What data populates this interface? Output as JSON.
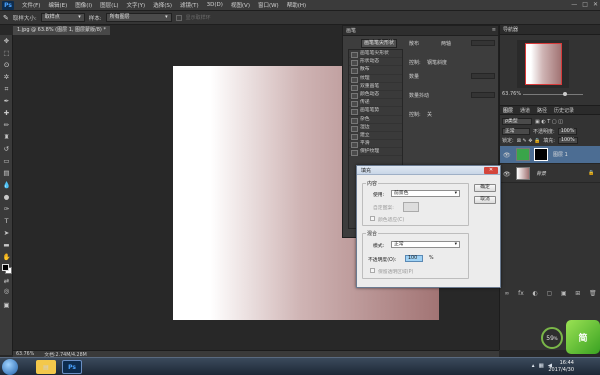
{
  "app": {
    "logo": "Ps",
    "menu": [
      "文件(F)",
      "编辑(E)",
      "图像(I)",
      "图层(L)",
      "文字(Y)",
      "选择(S)",
      "滤镜(T)",
      "3D(D)",
      "视图(V)",
      "窗口(W)",
      "帮助(H)"
    ],
    "window_controls": [
      "—",
      "□",
      "✕"
    ]
  },
  "options_bar": {
    "sample_size_label": "取样大小:",
    "sample_size_value": "取样点",
    "sample_label": "样本:",
    "sample_value": "所有图层",
    "show_ring_label": "显示取样环"
  },
  "document": {
    "tab_label": "1.jpg @ 63.8% (图层 1, 图层蒙版/8) *"
  },
  "history_panel": {
    "title": "画笔",
    "active_tab": "画笔笔尖形状",
    "items": [
      "画笔笔尖形状",
      "形状动态",
      "散布",
      "纹理",
      "双重画笔",
      "颜色动态",
      "传递",
      "画笔笔势",
      "杂色",
      "湿边",
      "建立",
      "平滑",
      "保护纹理"
    ],
    "right_labels": {
      "scatter": "散布",
      "both_axes": "两轴",
      "control_label": "控制:",
      "control_value": "钢笔斜度",
      "count": "数量",
      "count_jitter": "数量抖动",
      "control2_value": "关"
    }
  },
  "navigator": {
    "tabs": [
      "导航器"
    ],
    "zoom": "63.76%"
  },
  "layers_panel": {
    "tabs": [
      "图层",
      "通道",
      "路径",
      "历史记录"
    ],
    "kind_label": "ρ类型",
    "blend_mode": "正常",
    "opacity_label": "不透明度:",
    "opacity_value": "100%",
    "lock_label": "锁定:",
    "fill_label": "填充:",
    "fill_value": "100%",
    "layers": [
      {
        "name": "图层 1",
        "selected": true
      },
      {
        "name": "背景",
        "selected": false
      }
    ],
    "footer_icons": [
      "∞",
      "fx",
      "◐",
      "▢",
      "▣",
      "⊞",
      "🗑"
    ]
  },
  "status_bar": {
    "zoom": "63.76%",
    "doc_size": "文档:2.74M/4.28M"
  },
  "fill_dialog": {
    "title": "填充",
    "content_group": "内容",
    "use_label": "使用:",
    "use_value": "前景色",
    "custom_pattern_label": "自定图案:",
    "color_adaptation_label": "颜色适应(C)",
    "blending_group": "混合",
    "mode_label": "模式:",
    "mode_value": "正常",
    "opacity_label": "不透明度(O):",
    "opacity_value": "100",
    "opacity_unit": "%",
    "preserve_transparency_label": "保留透明区域(P)",
    "ok_label": "确定",
    "cancel_label": "取消",
    "close_glyph": "✕"
  },
  "overlay": {
    "percent": "59",
    "percent_unit": "%",
    "watermark": "简"
  },
  "taskbar": {
    "clock_time": "16:44",
    "clock_date": "2017/4/30"
  },
  "colors": {
    "foreground": "#000000",
    "background": "#ffffff",
    "gradient_end": "#a27474",
    "accent_selection": "#4c6d93"
  }
}
